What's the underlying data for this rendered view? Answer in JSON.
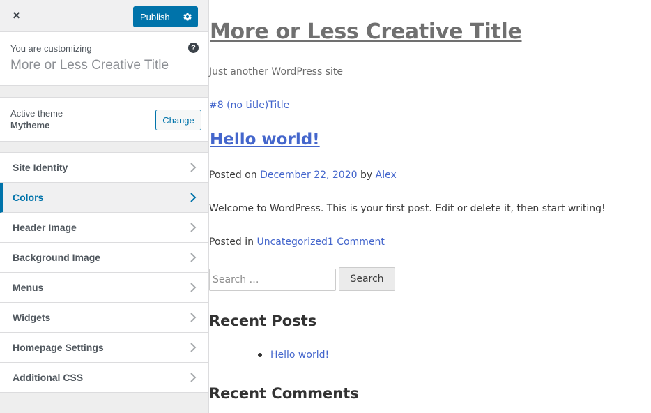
{
  "customizer": {
    "close_label": "×",
    "publish_label": "Publish",
    "info": {
      "customizing_label": "You are customizing",
      "site_title": "More or Less Creative Title",
      "help_glyph": "?"
    },
    "theme": {
      "label": "Active theme",
      "name": "Mytheme",
      "change_label": "Change"
    },
    "sections": [
      {
        "label": "Site Identity",
        "active": false
      },
      {
        "label": "Colors",
        "active": true
      },
      {
        "label": "Header Image",
        "active": false
      },
      {
        "label": "Background Image",
        "active": false
      },
      {
        "label": "Menus",
        "active": false
      },
      {
        "label": "Widgets",
        "active": false
      },
      {
        "label": "Homepage Settings",
        "active": false
      },
      {
        "label": "Additional CSS",
        "active": false
      }
    ],
    "colors": {
      "accent": "#0073aa",
      "link": "#4466cc"
    }
  },
  "preview": {
    "site_title": "More or Less Creative Title",
    "tagline": "Just another WordPress site",
    "menu_link": "#8 (no title)Title",
    "post": {
      "title": "Hello world!",
      "posted_on_label": "Posted on",
      "date": "December 22, 2020",
      "by_label": "by",
      "author": "Alex",
      "content": "Welcome to WordPress. This is your first post. Edit or delete it, then start writing!",
      "posted_in_label": "Posted in",
      "category_and_comments": "Uncategorized1 Comment"
    },
    "search": {
      "placeholder": "Search …",
      "button_label": "Search"
    },
    "recent_posts": {
      "title": "Recent Posts",
      "items": [
        "Hello world!"
      ]
    },
    "recent_comments": {
      "title": "Recent Comments"
    }
  }
}
